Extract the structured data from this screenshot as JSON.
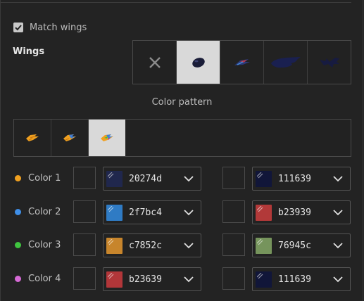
{
  "match_wings": {
    "label": "Match wings",
    "checked": true
  },
  "wings": {
    "label": "Wings",
    "options": [
      {
        "name": "none",
        "icon": "close-icon"
      },
      {
        "name": "wing-style-1",
        "icon": "oval-wing-icon",
        "selected": true
      },
      {
        "name": "wing-style-2",
        "icon": "feather-wing-icon"
      },
      {
        "name": "wing-style-3",
        "icon": "long-wing-icon"
      },
      {
        "name": "wing-style-4",
        "icon": "bat-wing-icon"
      }
    ]
  },
  "color_pattern": {
    "title": "Color pattern",
    "options": [
      {
        "name": "pattern-1",
        "selected": false
      },
      {
        "name": "pattern-2",
        "selected": false
      },
      {
        "name": "pattern-3",
        "selected": true
      }
    ]
  },
  "colors": [
    {
      "label": "Color 1",
      "dot": "#f0a020",
      "left_hex": "20274d",
      "left_color": "#20274d",
      "right_hex": "111639",
      "right_color": "#111639"
    },
    {
      "label": "Color 2",
      "dot": "#3f8fe8",
      "left_hex": "2f7bc4",
      "left_color": "#2f7bc4",
      "right_hex": "b23939",
      "right_color": "#b23939"
    },
    {
      "label": "Color 3",
      "dot": "#3fc43f",
      "left_hex": "c7852c",
      "left_color": "#c7852c",
      "right_hex": "76945c",
      "right_color": "#76945c"
    },
    {
      "label": "Color 4",
      "dot": "#d66ad6",
      "left_hex": "b23639",
      "left_color": "#b23639",
      "right_hex": "111639",
      "right_color": "#111639"
    }
  ]
}
